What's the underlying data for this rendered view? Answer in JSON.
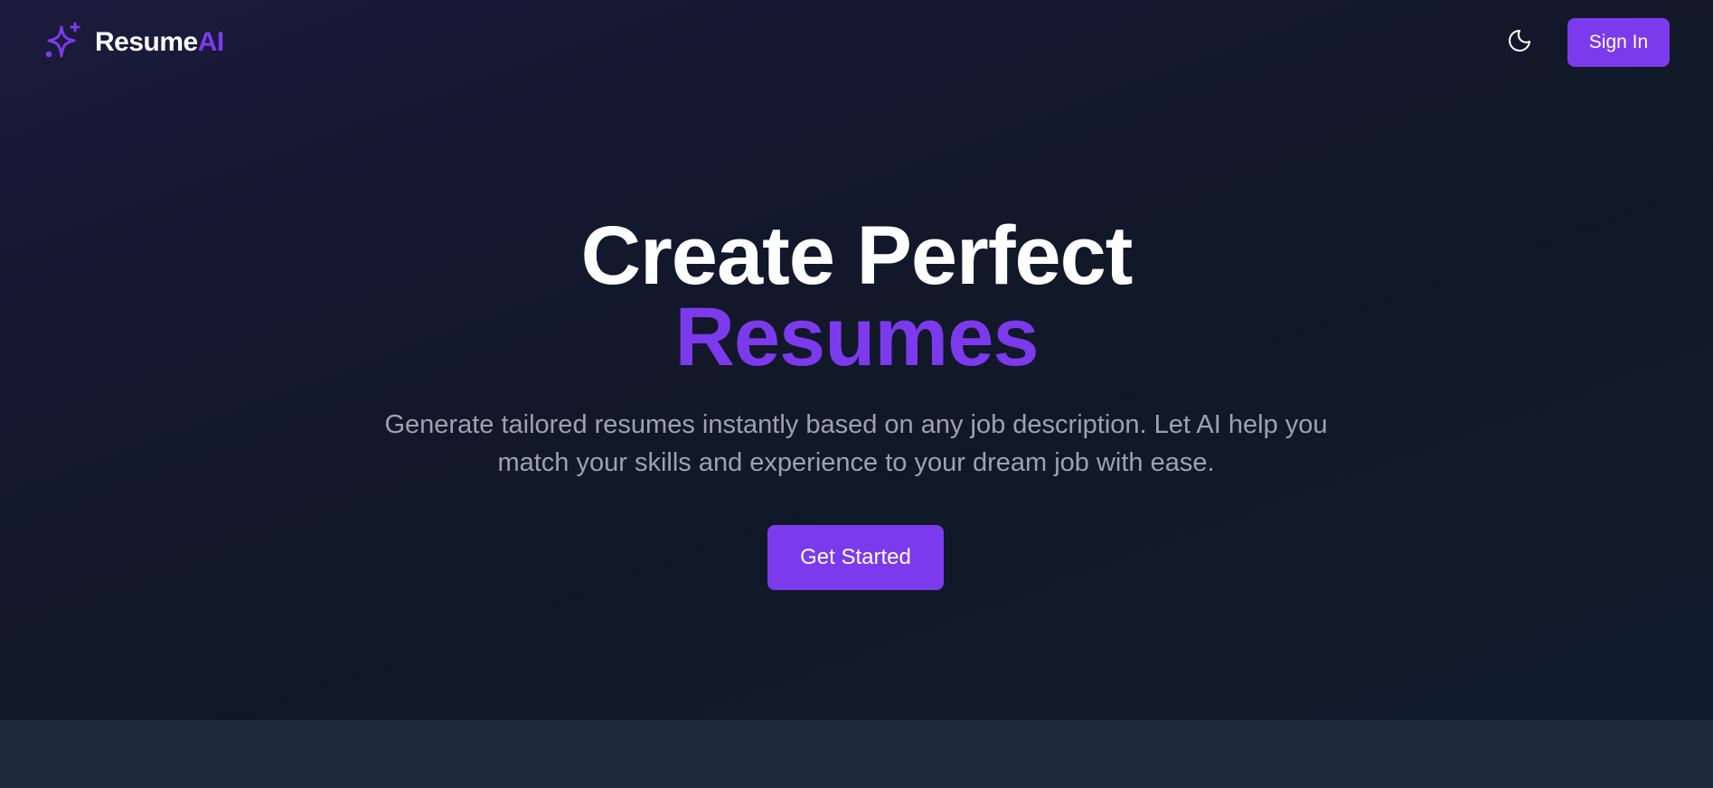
{
  "brand": {
    "name_main": "Resume",
    "name_accent": "AI",
    "icon": "sparkles-icon"
  },
  "header": {
    "theme_toggle_icon": "moon-icon",
    "signin_label": "Sign In"
  },
  "hero": {
    "title_line1": "Create Perfect",
    "title_line2": "Resumes",
    "subtitle": "Generate tailored resumes instantly based on any job description. Let AI help you match your skills and experience to your dream job with ease.",
    "cta_label": "Get Started"
  },
  "colors": {
    "accent": "#7c3aed",
    "background": "#111827",
    "subtitle": "#9ca3af",
    "band": "#1e293b"
  }
}
